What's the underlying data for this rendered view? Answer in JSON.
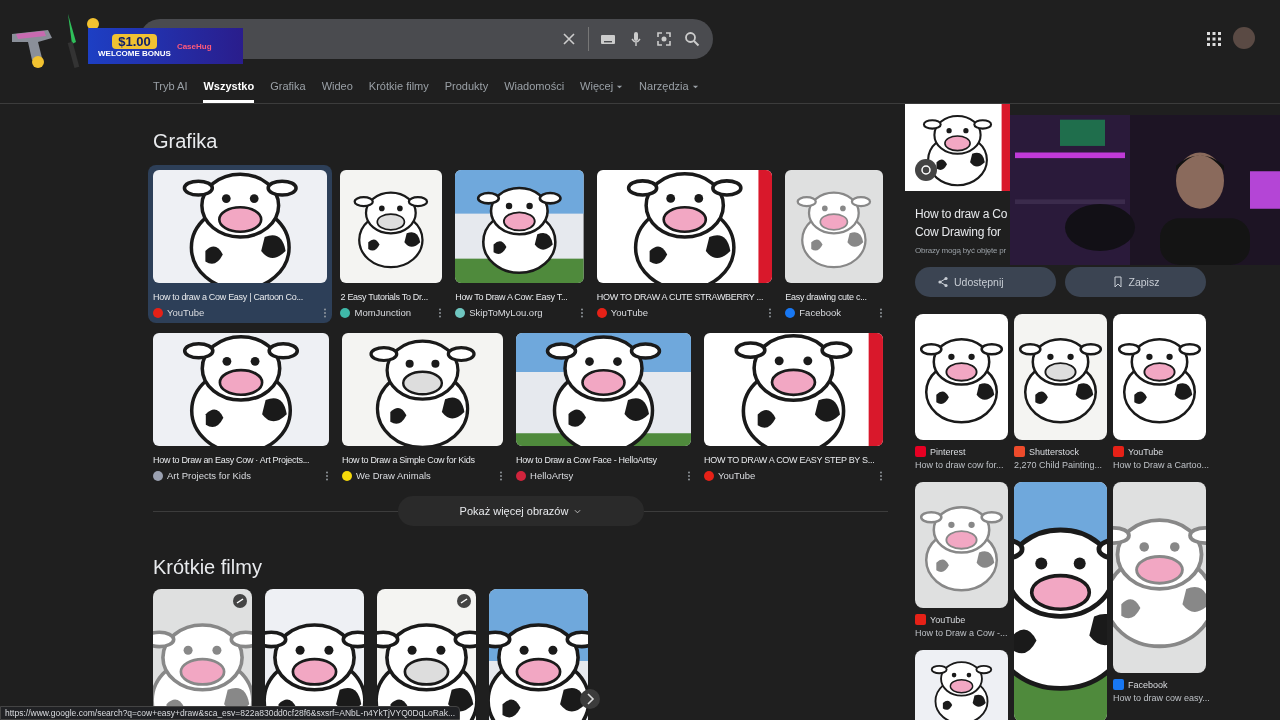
{
  "promo": {
    "amount": "$1.00",
    "label": "WELCOME BONUS",
    "brand": "CaseHug"
  },
  "tabs": [
    {
      "label": "Tryb AI",
      "selected": false,
      "kind": "link"
    },
    {
      "label": "Wszystko",
      "selected": true,
      "kind": "link"
    },
    {
      "label": "Grafika",
      "selected": false,
      "kind": "link"
    },
    {
      "label": "Wideo",
      "selected": false,
      "kind": "link"
    },
    {
      "label": "Krótkie filmy",
      "selected": false,
      "kind": "link"
    },
    {
      "label": "Produkty",
      "selected": false,
      "kind": "link"
    },
    {
      "label": "Wiadomości",
      "selected": false,
      "kind": "link"
    },
    {
      "label": "Więcej",
      "selected": false,
      "kind": "menu"
    },
    {
      "label": "Narzędzia",
      "selected": false,
      "kind": "menu"
    }
  ],
  "images": {
    "heading": "Grafika",
    "rows": [
      [
        {
          "title": "How to draw a Cow Easy | Cartoon Co...",
          "source": "YouTube",
          "color": "#e62117",
          "selected": true
        },
        {
          "title": "2 Easy Tutorials To Dr...",
          "source": "MomJunction",
          "color": "#3fb8a8",
          "selected": false
        },
        {
          "title": "How To Draw A Cow: Easy T...",
          "source": "SkipToMyLou.org",
          "color": "#6fc6c0",
          "selected": false
        },
        {
          "title": "HOW TO DRAW A CUTE STRAWBERRY ...",
          "source": "YouTube",
          "color": "#e62117",
          "selected": false
        },
        {
          "title": "Easy drawing cute c...",
          "source": "Facebook",
          "color": "#1877f2",
          "selected": false
        }
      ],
      [
        {
          "title": "How to Draw an Easy Cow · Art Projects...",
          "source": "Art Projects for Kids",
          "color": "#9aa0b0",
          "selected": false
        },
        {
          "title": "How to Draw a Simple Cow for Kids",
          "source": "We Draw Animals",
          "color": "#f5d90a",
          "selected": false
        },
        {
          "title": "How to Draw a Cow Face - HelloArtsy",
          "source": "HelloArtsy",
          "color": "#d0243c",
          "selected": false
        },
        {
          "title": "HOW TO DRAW A COW EASY STEP BY S...",
          "source": "YouTube",
          "color": "#e62117",
          "selected": false
        }
      ]
    ],
    "more_button": "Pokaż więcej obrazów"
  },
  "shorts": {
    "heading": "Krótkie filmy",
    "items": [
      {
        "badge": true
      },
      {
        "badge": false
      },
      {
        "badge": true
      },
      {
        "badge": false
      }
    ]
  },
  "panel": {
    "title_lines": [
      "How to draw a Co",
      "Cow Drawing for"
    ],
    "notice": "Obrazy mogą być objęte pr",
    "buttons": [
      {
        "label": "Udostępnij",
        "kind": "share"
      },
      {
        "label": "Zapisz",
        "kind": "save"
      }
    ],
    "columns": [
      [
        {
          "kind": "result",
          "source": "Pinterest",
          "color": "#e60023",
          "title": "How to draw cow for..."
        },
        {
          "kind": "result",
          "source": "YouTube",
          "color": "#e62117",
          "title": "How to Draw a Cow -..."
        },
        {
          "kind": "picture"
        }
      ],
      [
        {
          "kind": "result",
          "source": "Shutterstock",
          "color": "#ee4b2b",
          "title": "2,270 Child Painting..."
        },
        {
          "kind": "picture"
        }
      ],
      [
        {
          "kind": "result",
          "source": "YouTube",
          "color": "#e62117",
          "title": "How to Draw a Cartoo..."
        },
        {
          "kind": "result",
          "source": "Facebook",
          "color": "#1877f2",
          "title": "How to draw cow easy..."
        }
      ]
    ]
  },
  "status_url": "https://www.google.com/search?q=cow+easy+draw&sca_esv=822a830dd0cf28f6&sxsrf=ANbL-n4YkTjVYQ0DqLoRak..."
}
